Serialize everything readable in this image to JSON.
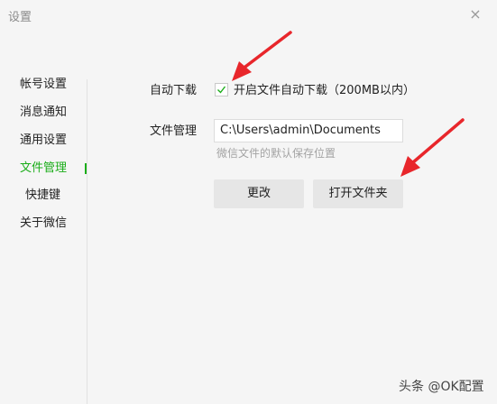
{
  "window": {
    "title": "设置",
    "close_icon": "×"
  },
  "sidebar": {
    "items": [
      {
        "label": "帐号设置",
        "active": false
      },
      {
        "label": "消息通知",
        "active": false
      },
      {
        "label": "通用设置",
        "active": false
      },
      {
        "label": "文件管理",
        "active": true
      },
      {
        "label": "快捷键",
        "active": false
      },
      {
        "label": "关于微信",
        "active": false
      }
    ]
  },
  "file_settings": {
    "auto_download_label": "自动下载",
    "auto_download_checkbox_text": "开启文件自动下载（200MB以内）",
    "auto_download_checked": true,
    "file_manage_label": "文件管理",
    "path_value": "C:\\Users\\admin\\Documents",
    "path_hint": "微信文件的默认保存位置",
    "change_button": "更改",
    "open_folder_button": "打开文件夹"
  },
  "watermark": {
    "text": "头条 @OK配置"
  },
  "colors": {
    "accent": "#1aad19",
    "arrow": "#e8262b",
    "background": "#f5f5f5"
  }
}
